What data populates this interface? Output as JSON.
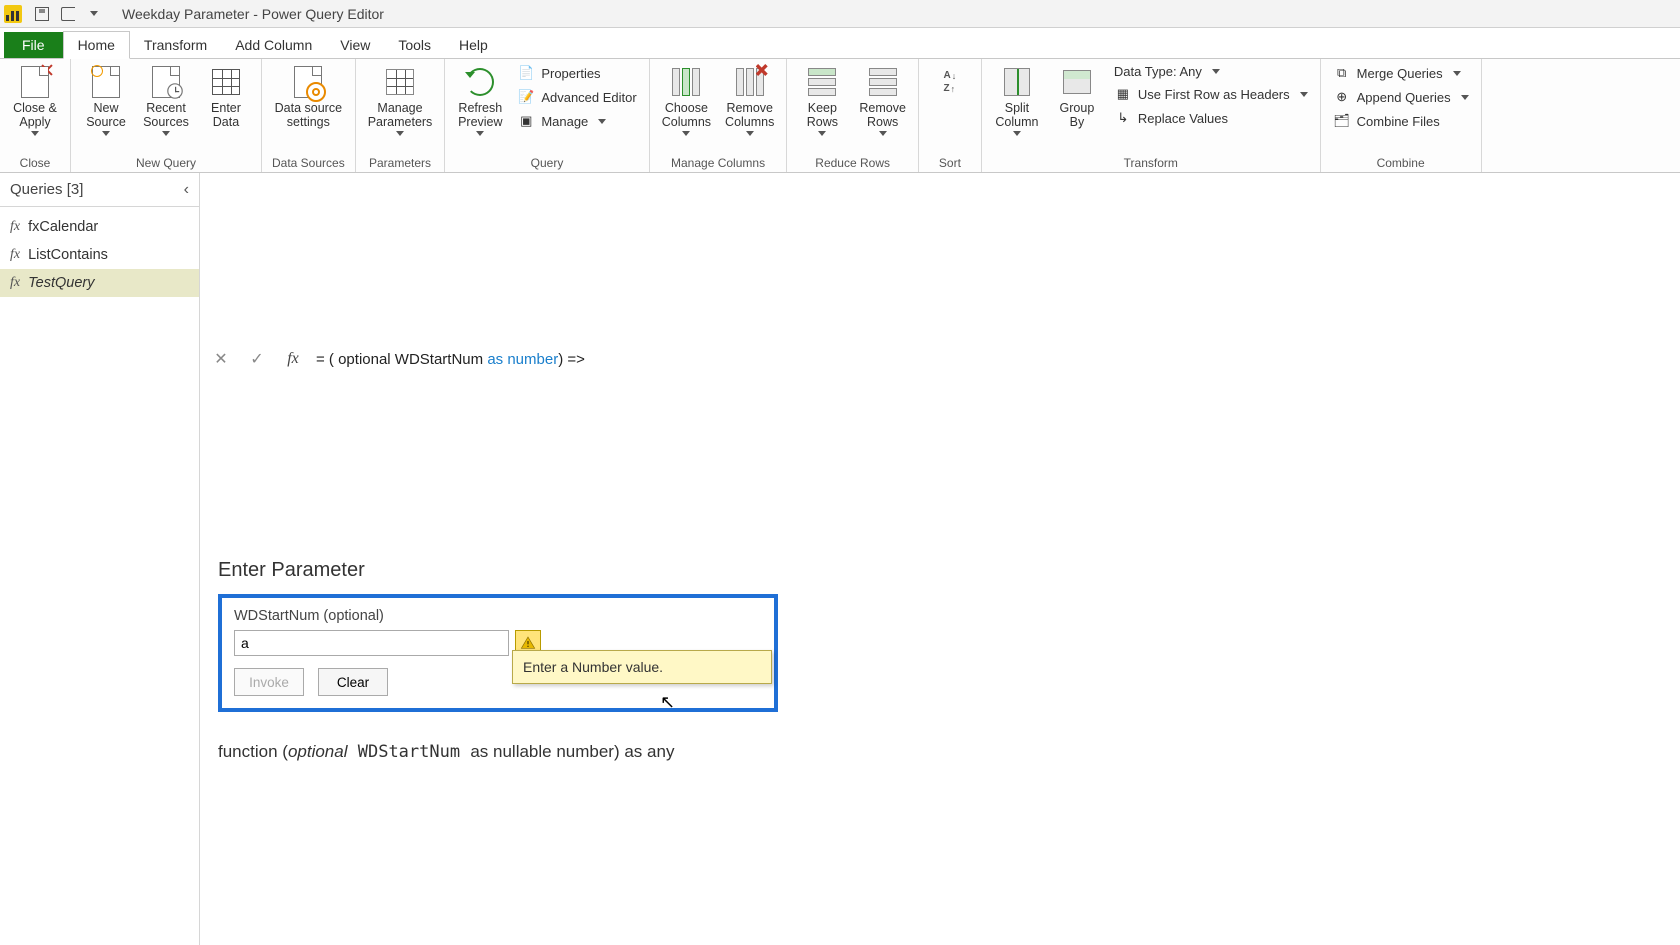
{
  "titlebar": {
    "title": "Weekday Parameter - Power Query Editor"
  },
  "tabs": {
    "file": "File",
    "home": "Home",
    "transform": "Transform",
    "addcolumn": "Add Column",
    "view": "View",
    "tools": "Tools",
    "help": "Help"
  },
  "ribbon": {
    "close": {
      "closeapply": "Close &\nApply",
      "group": "Close"
    },
    "newquery": {
      "newsource": "New\nSource",
      "recent": "Recent\nSources",
      "enterdata": "Enter\nData",
      "group": "New Query"
    },
    "datasources": {
      "settings": "Data source\nsettings",
      "group": "Data Sources"
    },
    "parameters": {
      "manage": "Manage\nParameters",
      "group": "Parameters"
    },
    "query": {
      "refresh": "Refresh\nPreview",
      "properties": "Properties",
      "advanced": "Advanced Editor",
      "manage": "Manage",
      "group": "Query"
    },
    "managecols": {
      "choose": "Choose\nColumns",
      "remove": "Remove\nColumns",
      "group": "Manage Columns"
    },
    "reducerows": {
      "keep": "Keep\nRows",
      "remove": "Remove\nRows",
      "group": "Reduce Rows"
    },
    "sort": {
      "group": "Sort"
    },
    "transform": {
      "split": "Split\nColumn",
      "groupby": "Group\nBy",
      "datatype": "Data Type: Any",
      "firstrow": "Use First Row as Headers",
      "replace": "Replace Values",
      "group": "Transform"
    },
    "combine": {
      "merge": "Merge Queries",
      "append": "Append Queries",
      "combinefiles": "Combine Files",
      "group": "Combine"
    }
  },
  "queries_panel": {
    "header": "Queries [3]",
    "items": [
      "fxCalendar",
      "ListContains",
      "TestQuery"
    ]
  },
  "formula_bar": {
    "prefix": "= ( optional WDStartNum ",
    "kw_as": "as",
    "mid": " ",
    "kw_type": "number",
    "suffix": ") =>"
  },
  "content": {
    "heading": "Enter Parameter",
    "param_label": "WDStartNum (optional)",
    "param_value": "a",
    "invoke": "Invoke",
    "clear": "Clear",
    "tooltip": "Enter a Number value."
  },
  "signature": {
    "t1": "function (",
    "t2": "optional",
    "t3": " WDStartNum ",
    "t4": "as nullable number) as any"
  }
}
